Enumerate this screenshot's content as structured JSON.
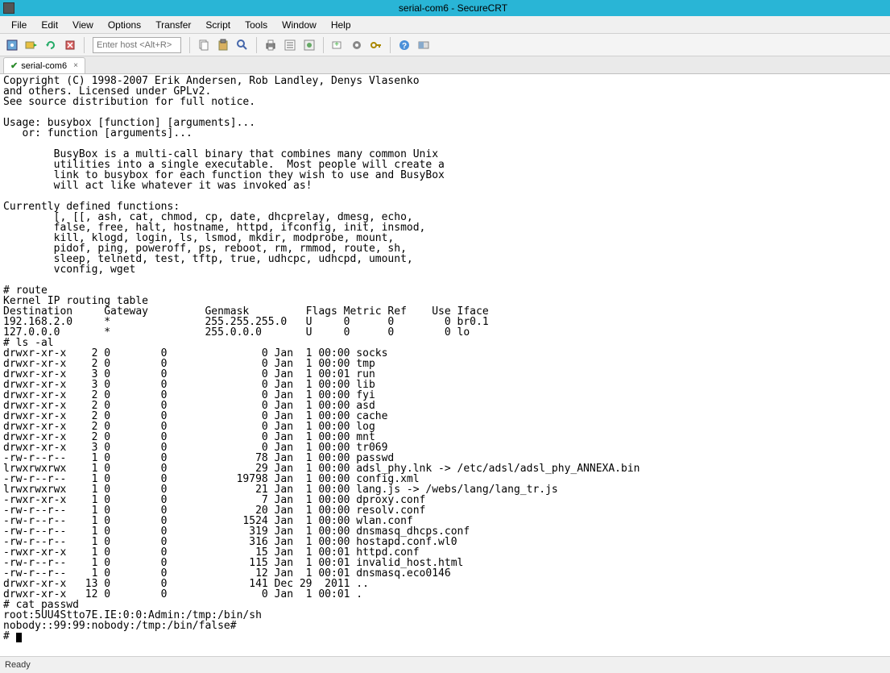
{
  "title": "serial-com6 - SecureCRT",
  "menu": [
    "File",
    "Edit",
    "View",
    "Options",
    "Transfer",
    "Script",
    "Tools",
    "Window",
    "Help"
  ],
  "host_placeholder": "Enter host <Alt+R>",
  "tab": {
    "label": "serial-com6",
    "close": "×"
  },
  "status": "Ready",
  "terminal_lines": [
    "Copyright (C) 1998-2007 Erik Andersen, Rob Landley, Denys Vlasenko",
    "and others. Licensed under GPLv2.",
    "See source distribution for full notice.",
    "",
    "Usage: busybox [function] [arguments]...",
    "   or: function [arguments]...",
    "",
    "        BusyBox is a multi-call binary that combines many common Unix",
    "        utilities into a single executable.  Most people will create a",
    "        link to busybox for each function they wish to use and BusyBox",
    "        will act like whatever it was invoked as!",
    "",
    "Currently defined functions:",
    "        [, [[, ash, cat, chmod, cp, date, dhcprelay, dmesg, echo,",
    "        false, free, halt, hostname, httpd, ifconfig, init, insmod,",
    "        kill, klogd, login, ls, lsmod, mkdir, modprobe, mount,",
    "        pidof, ping, poweroff, ps, reboot, rm, rmmod, route, sh,",
    "        sleep, telnetd, test, tftp, true, udhcpc, udhcpd, umount,",
    "        vconfig, wget",
    "",
    "# route",
    "Kernel IP routing table",
    "Destination     Gateway         Genmask         Flags Metric Ref    Use Iface",
    "192.168.2.0     *               255.255.255.0   U     0      0        0 br0.1",
    "127.0.0.0       *               255.0.0.0       U     0      0        0 lo",
    "# ls -al",
    "drwxr-xr-x    2 0        0               0 Jan  1 00:00 socks",
    "drwxr-xr-x    2 0        0               0 Jan  1 00:00 tmp",
    "drwxr-xr-x    3 0        0               0 Jan  1 00:01 run",
    "drwxr-xr-x    3 0        0               0 Jan  1 00:00 lib",
    "drwxr-xr-x    2 0        0               0 Jan  1 00:00 fyi",
    "drwxr-xr-x    2 0        0               0 Jan  1 00:00 asd",
    "drwxr-xr-x    2 0        0               0 Jan  1 00:00 cache",
    "drwxr-xr-x    2 0        0               0 Jan  1 00:00 log",
    "drwxr-xr-x    2 0        0               0 Jan  1 00:00 mnt",
    "drwxr-xr-x    3 0        0               0 Jan  1 00:00 tr069",
    "-rw-r--r--    1 0        0              78 Jan  1 00:00 passwd",
    "lrwxrwxrwx    1 0        0              29 Jan  1 00:00 adsl_phy.lnk -> /etc/adsl/adsl_phy_ANNEXA.bin",
    "-rw-r--r--    1 0        0           19798 Jan  1 00:00 config.xml",
    "lrwxrwxrwx    1 0        0              21 Jan  1 00:00 lang.js -> /webs/lang/lang_tr.js",
    "-rwxr-xr-x    1 0        0               7 Jan  1 00:00 dproxy.conf",
    "-rw-r--r--    1 0        0              20 Jan  1 00:00 resolv.conf",
    "-rw-r--r--    1 0        0            1524 Jan  1 00:00 wlan.conf",
    "-rw-r--r--    1 0        0             319 Jan  1 00:00 dnsmasq_dhcps.conf",
    "-rw-r--r--    1 0        0             316 Jan  1 00:00 hostapd.conf.wl0",
    "-rwxr-xr-x    1 0        0              15 Jan  1 00:01 httpd.conf",
    "-rw-r--r--    1 0        0             115 Jan  1 00:01 invalid_host.html",
    "-rw-r--r--    1 0        0              12 Jan  1 00:01 dnsmasq.eco0146",
    "drwxr-xr-x   13 0        0             141 Dec 29  2011 ..",
    "drwxr-xr-x   12 0        0               0 Jan  1 00:01 .",
    "# cat passwd",
    "root:5UU4Stto7E.IE:0:0:Admin:/tmp:/bin/sh",
    "nobody::99:99:nobody:/tmp:/bin/false#",
    "# "
  ]
}
